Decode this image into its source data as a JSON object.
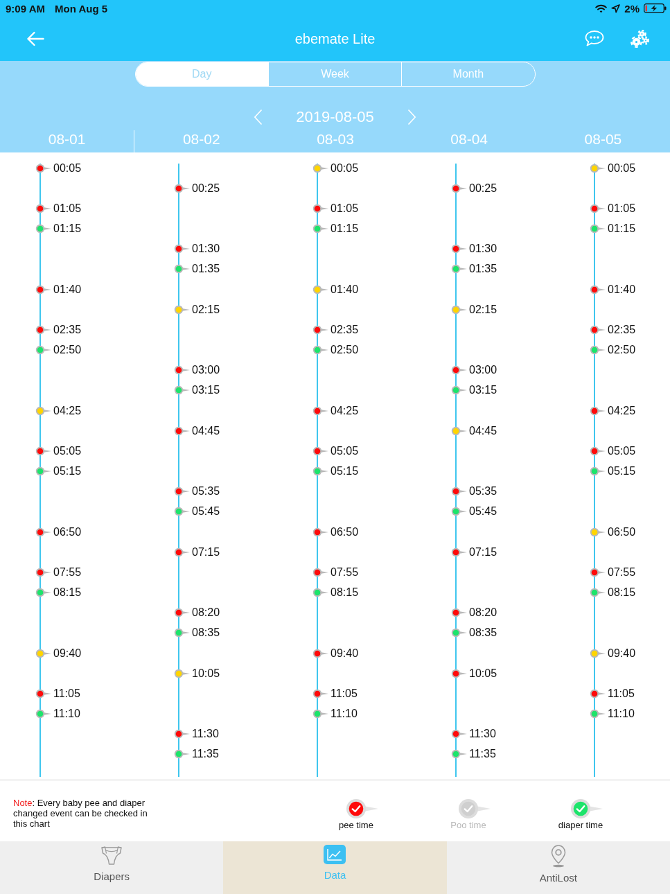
{
  "status_bar": {
    "time": "9:09 AM",
    "date": "Mon Aug 5",
    "battery": "2%"
  },
  "nav_bar": {
    "title": "ebemate Lite"
  },
  "period_tabs": [
    {
      "label": "Day",
      "selected": true
    },
    {
      "label": "Week",
      "selected": false
    },
    {
      "label": "Month",
      "selected": false
    }
  ],
  "date_nav": {
    "date": "2019-08-05"
  },
  "days": [
    {
      "date": "08-01",
      "events": [
        {
          "time": "00:05",
          "color": "#ff0a0a"
        },
        {
          "time": "01:05",
          "color": "#ff0a0a"
        },
        {
          "time": "01:15",
          "color": "#1de46b"
        },
        {
          "time": "01:40",
          "color": "#ff0a0a"
        },
        {
          "time": "02:35",
          "color": "#ff0a0a"
        },
        {
          "time": "02:50",
          "color": "#1de46b"
        },
        {
          "time": "04:25",
          "color": "#ffd500"
        },
        {
          "time": "05:05",
          "color": "#ff0a0a"
        },
        {
          "time": "05:15",
          "color": "#1de46b"
        },
        {
          "time": "06:50",
          "color": "#ff0a0a"
        },
        {
          "time": "07:55",
          "color": "#ff0a0a"
        },
        {
          "time": "08:15",
          "color": "#1de46b"
        },
        {
          "time": "09:40",
          "color": "#ffd500"
        },
        {
          "time": "11:05",
          "color": "#ff0a0a"
        },
        {
          "time": "11:10",
          "color": "#1de46b"
        }
      ]
    },
    {
      "date": "08-02",
      "events": [
        {
          "time": "00:25",
          "color": "#ff0a0a"
        },
        {
          "time": "01:30",
          "color": "#ff0a0a"
        },
        {
          "time": "01:35",
          "color": "#1de46b"
        },
        {
          "time": "02:15",
          "color": "#ffd500"
        },
        {
          "time": "03:00",
          "color": "#ff0a0a"
        },
        {
          "time": "03:15",
          "color": "#1de46b"
        },
        {
          "time": "04:45",
          "color": "#ff0a0a"
        },
        {
          "time": "05:35",
          "color": "#ff0a0a"
        },
        {
          "time": "05:45",
          "color": "#1de46b"
        },
        {
          "time": "07:15",
          "color": "#ff0a0a"
        },
        {
          "time": "08:20",
          "color": "#ff0a0a"
        },
        {
          "time": "08:35",
          "color": "#1de46b"
        },
        {
          "time": "10:05",
          "color": "#ffd500"
        },
        {
          "time": "11:30",
          "color": "#ff0a0a"
        },
        {
          "time": "11:35",
          "color": "#1de46b"
        }
      ]
    },
    {
      "date": "08-03",
      "events": [
        {
          "time": "00:05",
          "color": "#ffd500"
        },
        {
          "time": "01:05",
          "color": "#ff0a0a"
        },
        {
          "time": "01:15",
          "color": "#1de46b"
        },
        {
          "time": "01:40",
          "color": "#ffd500"
        },
        {
          "time": "02:35",
          "color": "#ff0a0a"
        },
        {
          "time": "02:50",
          "color": "#1de46b"
        },
        {
          "time": "04:25",
          "color": "#ff0a0a"
        },
        {
          "time": "05:05",
          "color": "#ff0a0a"
        },
        {
          "time": "05:15",
          "color": "#1de46b"
        },
        {
          "time": "06:50",
          "color": "#ff0a0a"
        },
        {
          "time": "07:55",
          "color": "#ff0a0a"
        },
        {
          "time": "08:15",
          "color": "#1de46b"
        },
        {
          "time": "09:40",
          "color": "#ff0a0a"
        },
        {
          "time": "11:05",
          "color": "#ff0a0a"
        },
        {
          "time": "11:10",
          "color": "#1de46b"
        }
      ]
    },
    {
      "date": "08-04",
      "events": [
        {
          "time": "00:25",
          "color": "#ff0a0a"
        },
        {
          "time": "01:30",
          "color": "#ff0a0a"
        },
        {
          "time": "01:35",
          "color": "#1de46b"
        },
        {
          "time": "02:15",
          "color": "#ffd500"
        },
        {
          "time": "03:00",
          "color": "#ff0a0a"
        },
        {
          "time": "03:15",
          "color": "#1de46b"
        },
        {
          "time": "04:45",
          "color": "#ffd500"
        },
        {
          "time": "05:35",
          "color": "#ff0a0a"
        },
        {
          "time": "05:45",
          "color": "#1de46b"
        },
        {
          "time": "07:15",
          "color": "#ff0a0a"
        },
        {
          "time": "08:20",
          "color": "#ff0a0a"
        },
        {
          "time": "08:35",
          "color": "#1de46b"
        },
        {
          "time": "10:05",
          "color": "#ff0a0a"
        },
        {
          "time": "11:30",
          "color": "#ff0a0a"
        },
        {
          "time": "11:35",
          "color": "#1de46b"
        }
      ]
    },
    {
      "date": "08-05",
      "events": [
        {
          "time": "00:05",
          "color": "#ffd500"
        },
        {
          "time": "01:05",
          "color": "#ff0a0a"
        },
        {
          "time": "01:15",
          "color": "#1de46b"
        },
        {
          "time": "01:40",
          "color": "#ff0a0a"
        },
        {
          "time": "02:35",
          "color": "#ff0a0a"
        },
        {
          "time": "02:50",
          "color": "#1de46b"
        },
        {
          "time": "04:25",
          "color": "#ff0a0a"
        },
        {
          "time": "05:05",
          "color": "#ff0a0a"
        },
        {
          "time": "05:15",
          "color": "#1de46b"
        },
        {
          "time": "06:50",
          "color": "#ffd500"
        },
        {
          "time": "07:55",
          "color": "#ff0a0a"
        },
        {
          "time": "08:15",
          "color": "#1de46b"
        },
        {
          "time": "09:40",
          "color": "#ffd500"
        },
        {
          "time": "11:05",
          "color": "#ff0a0a"
        },
        {
          "time": "11:10",
          "color": "#1de46b"
        }
      ]
    }
  ],
  "legend": {
    "note": {
      "label": "Note",
      "text": ": Every baby pee and diaper changed event can be checked in this chart"
    },
    "items": [
      {
        "label": "pee time",
        "color": "#ff0a0a",
        "on": true
      },
      {
        "label": "Poo time",
        "color": "#cfcfcf",
        "on": false
      },
      {
        "label": "diaper time",
        "color": "#1de46b",
        "on": true
      }
    ]
  },
  "tab_bar": [
    {
      "label": "Diapers",
      "selected": false
    },
    {
      "label": "Data",
      "selected": true
    },
    {
      "label": "AntiLost",
      "selected": false
    }
  ]
}
